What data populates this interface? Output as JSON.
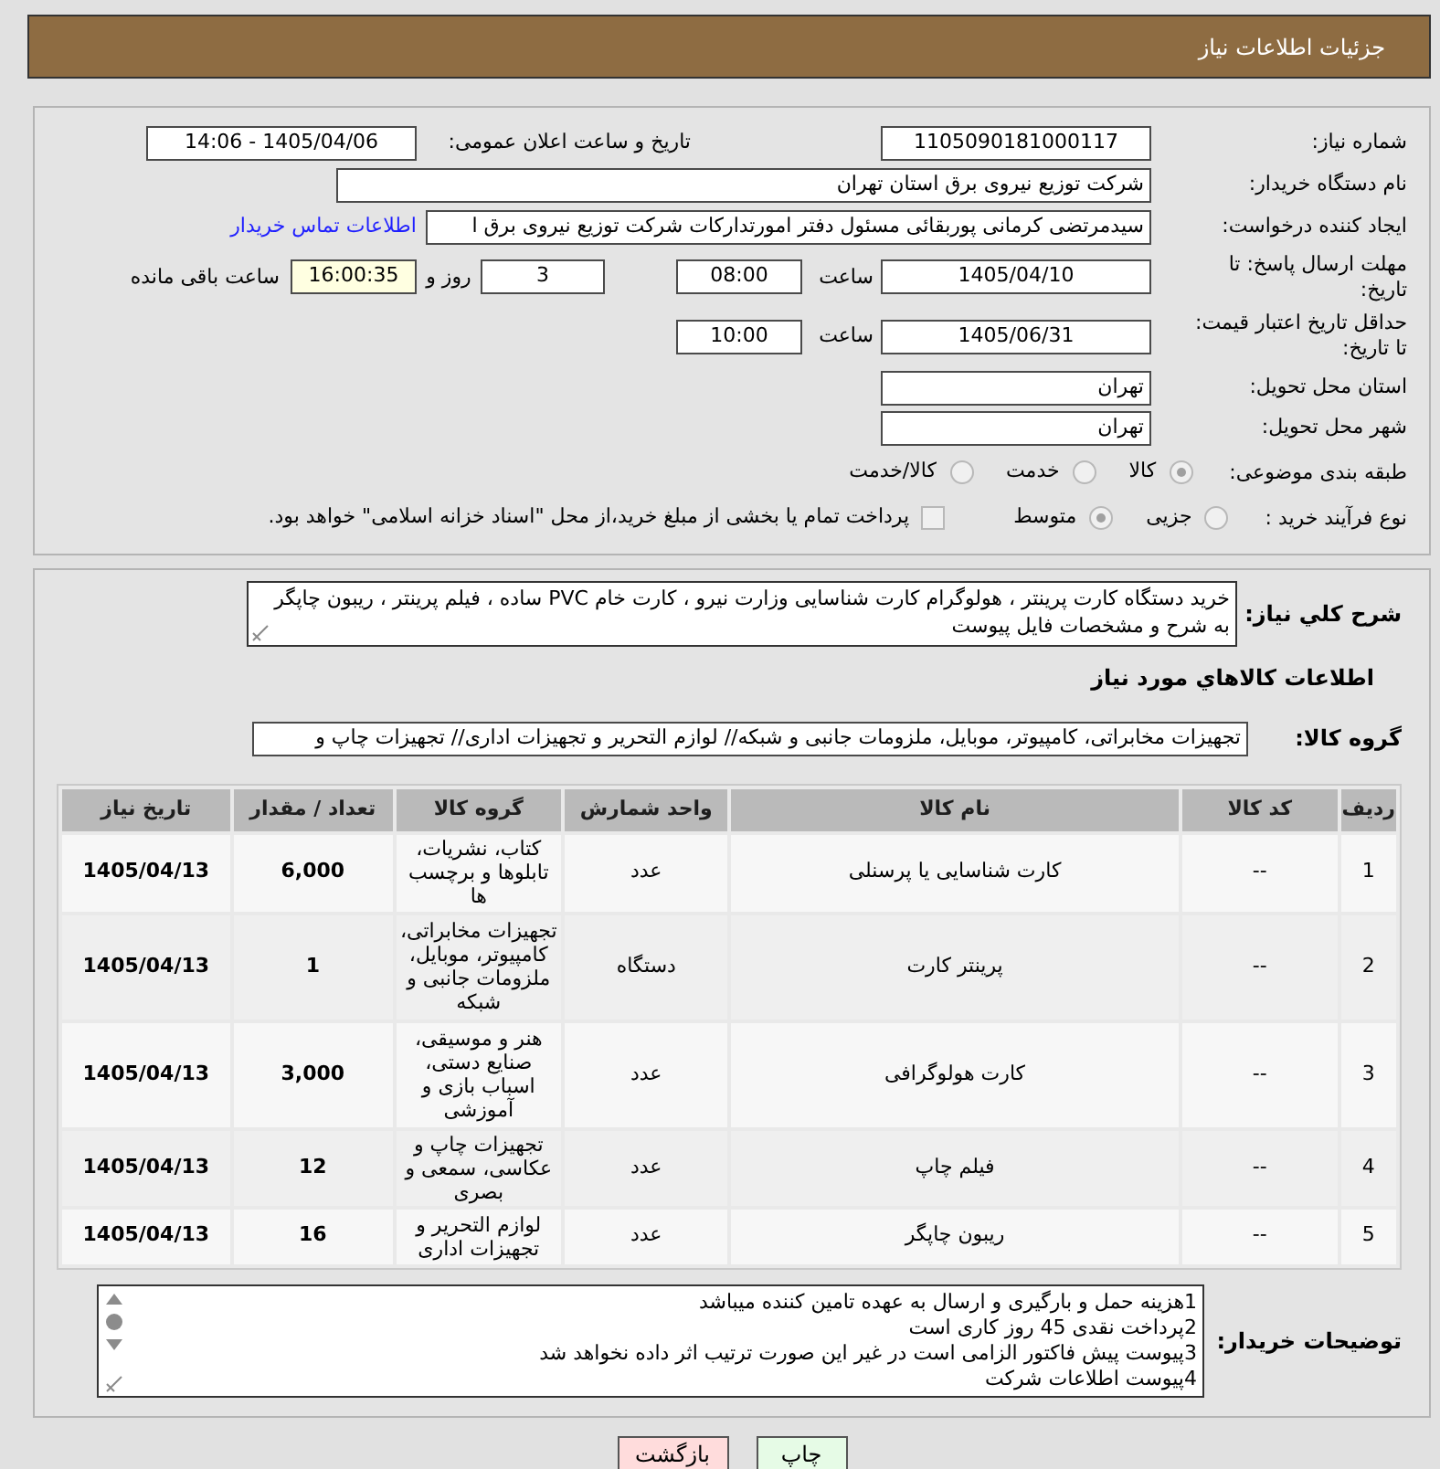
{
  "header": {
    "title": "جزئیات اطلاعات نیاز"
  },
  "need_number": {
    "label": "شماره نیاز:",
    "value": "1105090181000117"
  },
  "announcement": {
    "label": "تاریخ و ساعت اعلان عمومی:",
    "value": "1405/04/06 - 14:06"
  },
  "buyer_org": {
    "label": "نام دستگاه خریدار:",
    "value": "شرکت توزیع نیروی برق استان تهران"
  },
  "requester": {
    "label": "ایجاد کننده درخواست:",
    "value": "سیدمرتضی کرمانی پوربقائی مسئول دفتر امورتدارکات شرکت توزیع نیروی برق ا",
    "link": "اطلاعات تماس خریدار"
  },
  "response_deadline": {
    "label": "مهلت ارسال پاسخ: تا تاریخ:",
    "date": "1405/04/10",
    "time_label": "ساعت",
    "time": "08:00",
    "days": "3",
    "days_label": "روز و",
    "remaining": "16:00:35",
    "remaining_label": "ساعت باقی مانده"
  },
  "price_validity": {
    "label": "حداقل تاریخ اعتبار قیمت: تا تاریخ:",
    "date": "1405/06/31",
    "time_label": "ساعت",
    "time": "10:00"
  },
  "delivery_province": {
    "label": "استان محل تحویل:",
    "value": "تهران"
  },
  "delivery_city": {
    "label": "شهر محل تحویل:",
    "value": "تهران"
  },
  "subject_category": {
    "label": "طبقه بندی موضوعی:",
    "options": [
      {
        "label": "کالا",
        "selected": true,
        "disabled": true
      },
      {
        "label": "خدمت",
        "selected": false,
        "disabled": true
      },
      {
        "label": "کالا/خدمت",
        "selected": false,
        "disabled": true
      }
    ]
  },
  "purchase_process": {
    "label": "نوع فرآیند خرید :",
    "options": [
      {
        "label": "جزیی",
        "selected": false,
        "disabled": true
      },
      {
        "label": "متوسط",
        "selected": true,
        "disabled": true
      }
    ],
    "treasury": {
      "label": "پرداخت تمام یا بخشی از مبلغ خرید،از محل \"اسناد خزانه اسلامی\" خواهد بود.",
      "checked": false,
      "disabled": true
    }
  },
  "description": {
    "label": "شرح کلي نیاز:",
    "value": "خرید دستگاه کارت پرینتر ، هولوگرام کارت شناسایی وزارت نیرو ، کارت خام PVC ساده ، فیلم پرینتر ، ریبون چاپگر به شرح و مشخصات فایل پیوست"
  },
  "goods_heading": "اطلاعات کالاهاي مورد نیاز",
  "goods_group": {
    "label": "گروه کالا:",
    "value": "تجهیزات مخابراتی، کامپیوتر، موبایل، ملزومات جانبی و شبکه// لوازم التحریر و تجهیزات اداری// تجهیزات چاپ و"
  },
  "table": {
    "columns": [
      "ردیف",
      "کد کالا",
      "نام کالا",
      "واحد شمارش",
      "گروه کالا",
      "تعداد / مقدار",
      "تاریخ نیاز"
    ],
    "rows": [
      [
        "1",
        "--",
        "کارت شناسایی یا پرسنلی",
        "عدد",
        "کتاب، نشریات، تابلوها و برچسب ها",
        "6,000",
        "1405/04/13"
      ],
      [
        "2",
        "--",
        "پرینتر کارت",
        "دستگاه",
        "تجهیزات مخابراتی، کامپیوتر، موبایل، ملزومات جانبی و شبکه",
        "1",
        "1405/04/13"
      ],
      [
        "3",
        "--",
        "کارت هولوگرافی",
        "عدد",
        "هنر و موسیقی، صنایع دستی، اسباب بازی و آموزشی",
        "3,000",
        "1405/04/13"
      ],
      [
        "4",
        "--",
        "فیلم چاپ",
        "عدد",
        "تجهیزات چاپ و عکاسی، سمعی و بصری",
        "12",
        "1405/04/13"
      ],
      [
        "5",
        "--",
        "ریبون چاپگر",
        "عدد",
        "لوازم التحریر و تجهیزات اداری",
        "16",
        "1405/04/13"
      ]
    ]
  },
  "buyer_notes": {
    "label": "توضیحات خریدار:",
    "lines": [
      "1هزینه حمل و بارگیری و ارسال به عهده تامین کننده میباشد",
      "2پرداخت نقدی 45 روز کاری است",
      "3پیوست پیش فاکتور الزامی است در غیر این صورت ترتیب اثر داده نخواهد شد",
      "4پیوست اطلاعات شرکت"
    ]
  },
  "buttons": [
    {
      "label": "چاپ",
      "kind": "print"
    },
    {
      "label": "بازگشت",
      "kind": "back"
    }
  ]
}
